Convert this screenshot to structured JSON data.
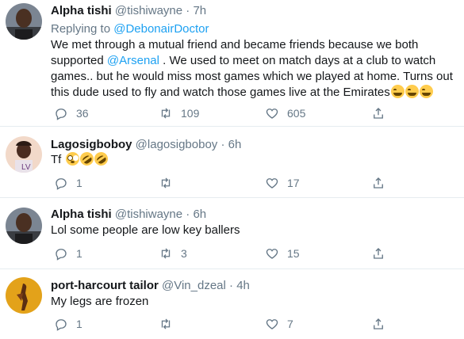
{
  "tweets": [
    {
      "name": "Alpha tishi",
      "handle": "@tishiwayne",
      "time": "7h",
      "dot": "·",
      "replying_prefix": "Replying to ",
      "replying_to": "@DebonairDoctor",
      "text_parts": [
        "We met through a mutual friend and became friends because we both supported ",
        "@Arsenal",
        " . We used to meet on match days at a club to watch games.. but he would miss most games which we played at home. Turns out this dude used to fly and watch those games live at the Emirates"
      ],
      "emojis": [
        "face-with-tears-of-joy",
        "face-with-tears-of-joy",
        "face-with-tears-of-joy"
      ],
      "replies": "36",
      "retweets": "109",
      "likes": "605"
    },
    {
      "name": "Lagosigboboy",
      "handle": "@lagosigboboy",
      "time": "6h",
      "dot": "·",
      "text": "Tf",
      "emojis": [
        "flushed-face",
        "rolling-on-floor-laughing",
        "rolling-on-floor-laughing"
      ],
      "replies": "1",
      "retweets": "",
      "likes": "17"
    },
    {
      "name": "Alpha tishi",
      "handle": "@tishiwayne",
      "time": "6h",
      "dot": "·",
      "text": "Lol some people are low key ballers",
      "replies": "1",
      "retweets": "3",
      "likes": "15"
    },
    {
      "name": "port-harcourt tailor",
      "handle": "@Vin_dzeal",
      "time": "4h",
      "dot": "·",
      "text": "My legs are frozen",
      "replies": "1",
      "retweets": "",
      "likes": "7"
    }
  ],
  "colors": {
    "link": "#1da1f2",
    "muted": "#657786",
    "text": "#14171a",
    "divider": "#e6ecf0"
  }
}
